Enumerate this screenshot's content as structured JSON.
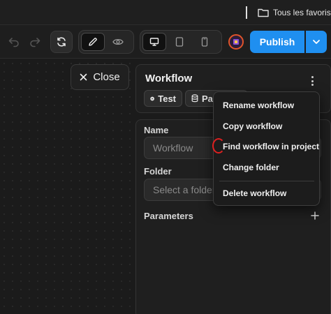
{
  "browser": {
    "bookmarks": {
      "folder_label": "Tous les favoris",
      "folder_icon": "folder-icon"
    }
  },
  "toolbar": {
    "undo_icon": "undo-icon",
    "redo_icon": "redo-icon",
    "refresh_icon": "refresh-icon",
    "edit_mode_icon": "pencil-icon",
    "preview_mode_icon": "eye-icon",
    "device_desktop_icon": "desktop-icon",
    "device_tablet_icon": "tablet-icon",
    "device_mobile_icon": "mobile-icon",
    "publish_label": "Publish",
    "accent_color": "#1f8ff0"
  },
  "canvas": {
    "close_label": "Close"
  },
  "workflow_panel": {
    "title": "Workflow",
    "test_label": "Test",
    "params_label": "Par"
  },
  "form": {
    "name_label": "Name",
    "name_placeholder": "Workflow",
    "folder_label": "Folder",
    "folder_placeholder": "Select a folder",
    "parameters_label": "Parameters"
  },
  "context_menu": {
    "items": [
      "Rename workflow",
      "Copy workflow",
      "Find workflow in project",
      "Change folder",
      "Delete workflow"
    ]
  }
}
